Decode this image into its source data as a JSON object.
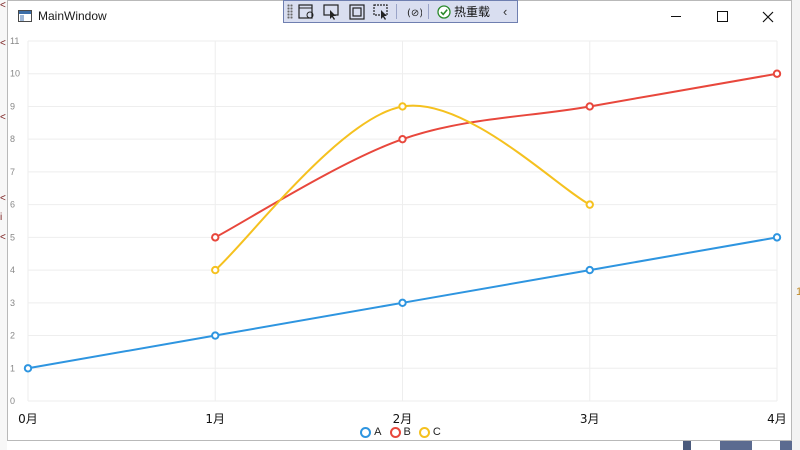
{
  "window": {
    "title": "MainWindow",
    "controls": {
      "minimize": "minimize",
      "maximize": "maximize",
      "close": "close"
    }
  },
  "debug_toolbar": {
    "hot_reload_label": "热重载",
    "collapse_glyph": "‹"
  },
  "background": {
    "right_mark": "1"
  },
  "chart_data": {
    "type": "line",
    "categories": [
      "0月",
      "1月",
      "2月",
      "3月",
      "4月"
    ],
    "ylim": [
      0,
      11
    ],
    "yticks": [
      0,
      1,
      2,
      3,
      4,
      5,
      6,
      7,
      8,
      9,
      10,
      11
    ],
    "grid": true,
    "legend_position": "bottom-center",
    "series": [
      {
        "name": "A",
        "color": "#2e95e0",
        "values": [
          1,
          2,
          3,
          4,
          5
        ],
        "smooth": false
      },
      {
        "name": "B",
        "color": "#e8473c",
        "values": [
          null,
          5,
          8,
          9,
          10
        ],
        "smooth": true
      },
      {
        "name": "C",
        "color": "#f5c11f",
        "values": [
          null,
          4,
          9,
          6,
          null
        ],
        "smooth": true
      }
    ]
  },
  "colors": {
    "grid": "#eeeeee",
    "axis_text": "#888888",
    "category_text": "#111111",
    "toolbar_bg": "#d9def0",
    "toolbar_border": "#6f7fb0"
  }
}
